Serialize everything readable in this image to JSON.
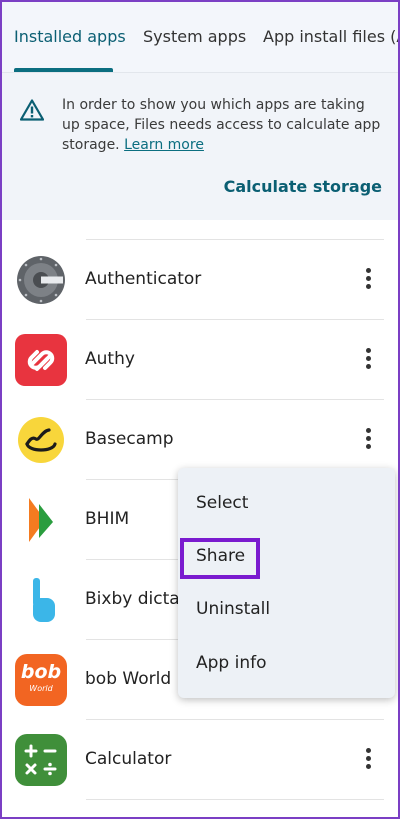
{
  "tabs": [
    {
      "label": "Installed apps",
      "active": true
    },
    {
      "label": "System apps",
      "active": false
    },
    {
      "label": "App install files (APKs)",
      "active": false
    }
  ],
  "banner": {
    "message": "In order to show you which apps are taking up space, Files needs access to calculate app storage.",
    "link": "Learn more",
    "action": "Calculate storage",
    "icon": "warning-icon"
  },
  "apps": [
    {
      "name": "Authenticator",
      "icon": "authenticator-icon"
    },
    {
      "name": "Authy",
      "icon": "authy-icon"
    },
    {
      "name": "Basecamp",
      "icon": "basecamp-icon"
    },
    {
      "name": "BHIM",
      "icon": "bhim-icon"
    },
    {
      "name": "Bixby dictation",
      "icon": "bixby-icon"
    },
    {
      "name": "bob World",
      "icon": "bob-world-icon",
      "icon_text_1": "bob",
      "icon_text_2": "World"
    },
    {
      "name": "Calculator",
      "icon": "calculator-icon"
    }
  ],
  "menu": {
    "items": [
      "Select",
      "Share",
      "Uninstall",
      "App info"
    ],
    "highlighted": "Share"
  },
  "colors": {
    "accent": "#0b6e80",
    "highlight": "#7a1bcf",
    "authy_red": "#e8343f",
    "basecamp_yellow": "#f8d63b",
    "bob_orange": "#f26522",
    "calculator_green": "#3f8f3a"
  }
}
